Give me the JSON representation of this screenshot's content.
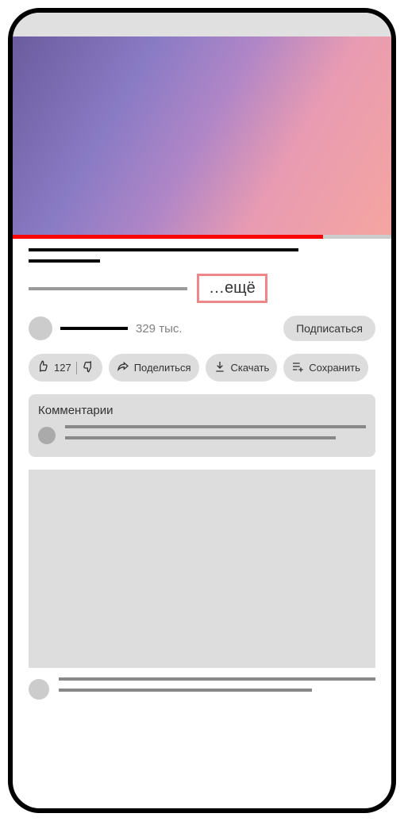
{
  "more_label": "…ещё",
  "channel": {
    "sub_count": "329 тыс.",
    "subscribe_label": "Подписаться"
  },
  "actions": {
    "like_count": "127",
    "share_label": "Поделиться",
    "download_label": "Скачать",
    "save_label": "Сохранить"
  },
  "comments": {
    "title": "Комментарии"
  }
}
